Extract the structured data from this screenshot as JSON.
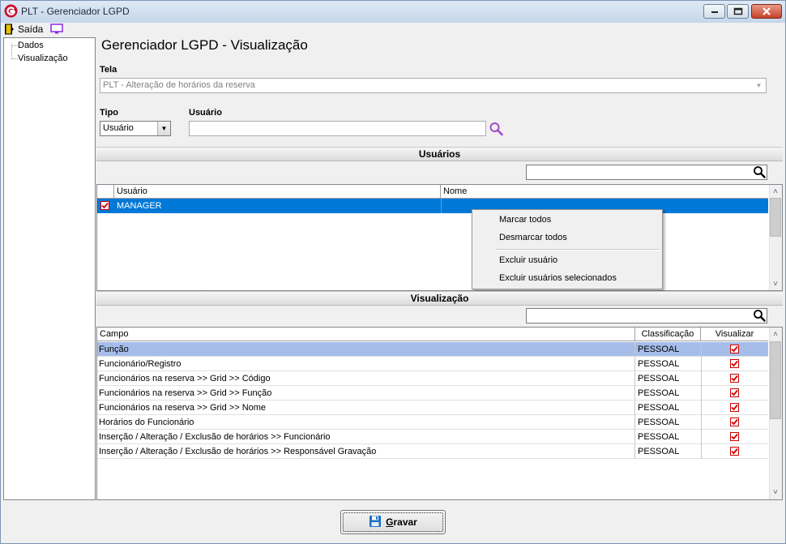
{
  "window": {
    "title": "PLT - Gerenciador LGPD",
    "controls": {
      "minimize": "minimize",
      "maximize": "maximize",
      "close": "close"
    }
  },
  "menu": {
    "exit_label": "Saída"
  },
  "tree": {
    "items": [
      {
        "label": "Dados"
      },
      {
        "label": "Visualização"
      }
    ]
  },
  "page": {
    "title": "Gerenciador LGPD - Visualização"
  },
  "form": {
    "tela_label": "Tela",
    "tela_value": "PLT - Alteração de horários da reserva",
    "tipo_label": "Tipo",
    "tipo_value": "Usuário",
    "usuario_label": "Usuário",
    "usuario_value": ""
  },
  "usuarios_section": {
    "header": "Usuários",
    "filter_value": "",
    "columns": {
      "usuario": "Usuário",
      "nome": "Nome"
    },
    "rows": [
      {
        "checked": true,
        "usuario": "MANAGER",
        "nome": "",
        "selected": true
      }
    ]
  },
  "context_menu": {
    "items": [
      {
        "label": "Marcar todos"
      },
      {
        "label": "Desmarcar todos"
      },
      {
        "label": "Excluir usuário"
      },
      {
        "label": "Excluir usuários selecionados"
      }
    ]
  },
  "visualizacao_section": {
    "header": "Visualização",
    "filter_value": "",
    "columns": {
      "campo": "Campo",
      "classificacao": "Classificação",
      "visualizar": "Visualizar"
    },
    "rows": [
      {
        "campo": "Função",
        "classificacao": "PESSOAL",
        "visualizar": true
      },
      {
        "campo": "Funcionário/Registro",
        "classificacao": "PESSOAL",
        "visualizar": true
      },
      {
        "campo": "Funcionários na reserva >> Grid >> Código",
        "classificacao": "PESSOAL",
        "visualizar": true
      },
      {
        "campo": "Funcionários na reserva >> Grid >> Função",
        "classificacao": "PESSOAL",
        "visualizar": true
      },
      {
        "campo": "Funcionários na reserva >> Grid >> Nome",
        "classificacao": "PESSOAL",
        "visualizar": true
      },
      {
        "campo": "Horários do Funcionário",
        "classificacao": "PESSOAL",
        "visualizar": true
      },
      {
        "campo": "Inserção / Alteração / Exclusão de horários >> Funcionário",
        "classificacao": "PESSOAL",
        "visualizar": true
      },
      {
        "campo": "Inserção / Alteração / Exclusão de horários >> Responsável Gravação",
        "classificacao": "PESSOAL",
        "visualizar": true
      }
    ]
  },
  "footer": {
    "save_label": "Gravar",
    "save_mnemonic": "G",
    "save_rest": "ravar"
  },
  "colors": {
    "selection": "#0078d7",
    "row_highlight": "#a6bdea",
    "check": "#cc0000",
    "search_icon": "#a24ac8"
  },
  "icons": {
    "app_logo": "app-logo-icon",
    "exit": "exit-door-icon",
    "monitor": "monitor-icon",
    "search": "magnifier-icon",
    "save": "floppy-disk-icon"
  }
}
